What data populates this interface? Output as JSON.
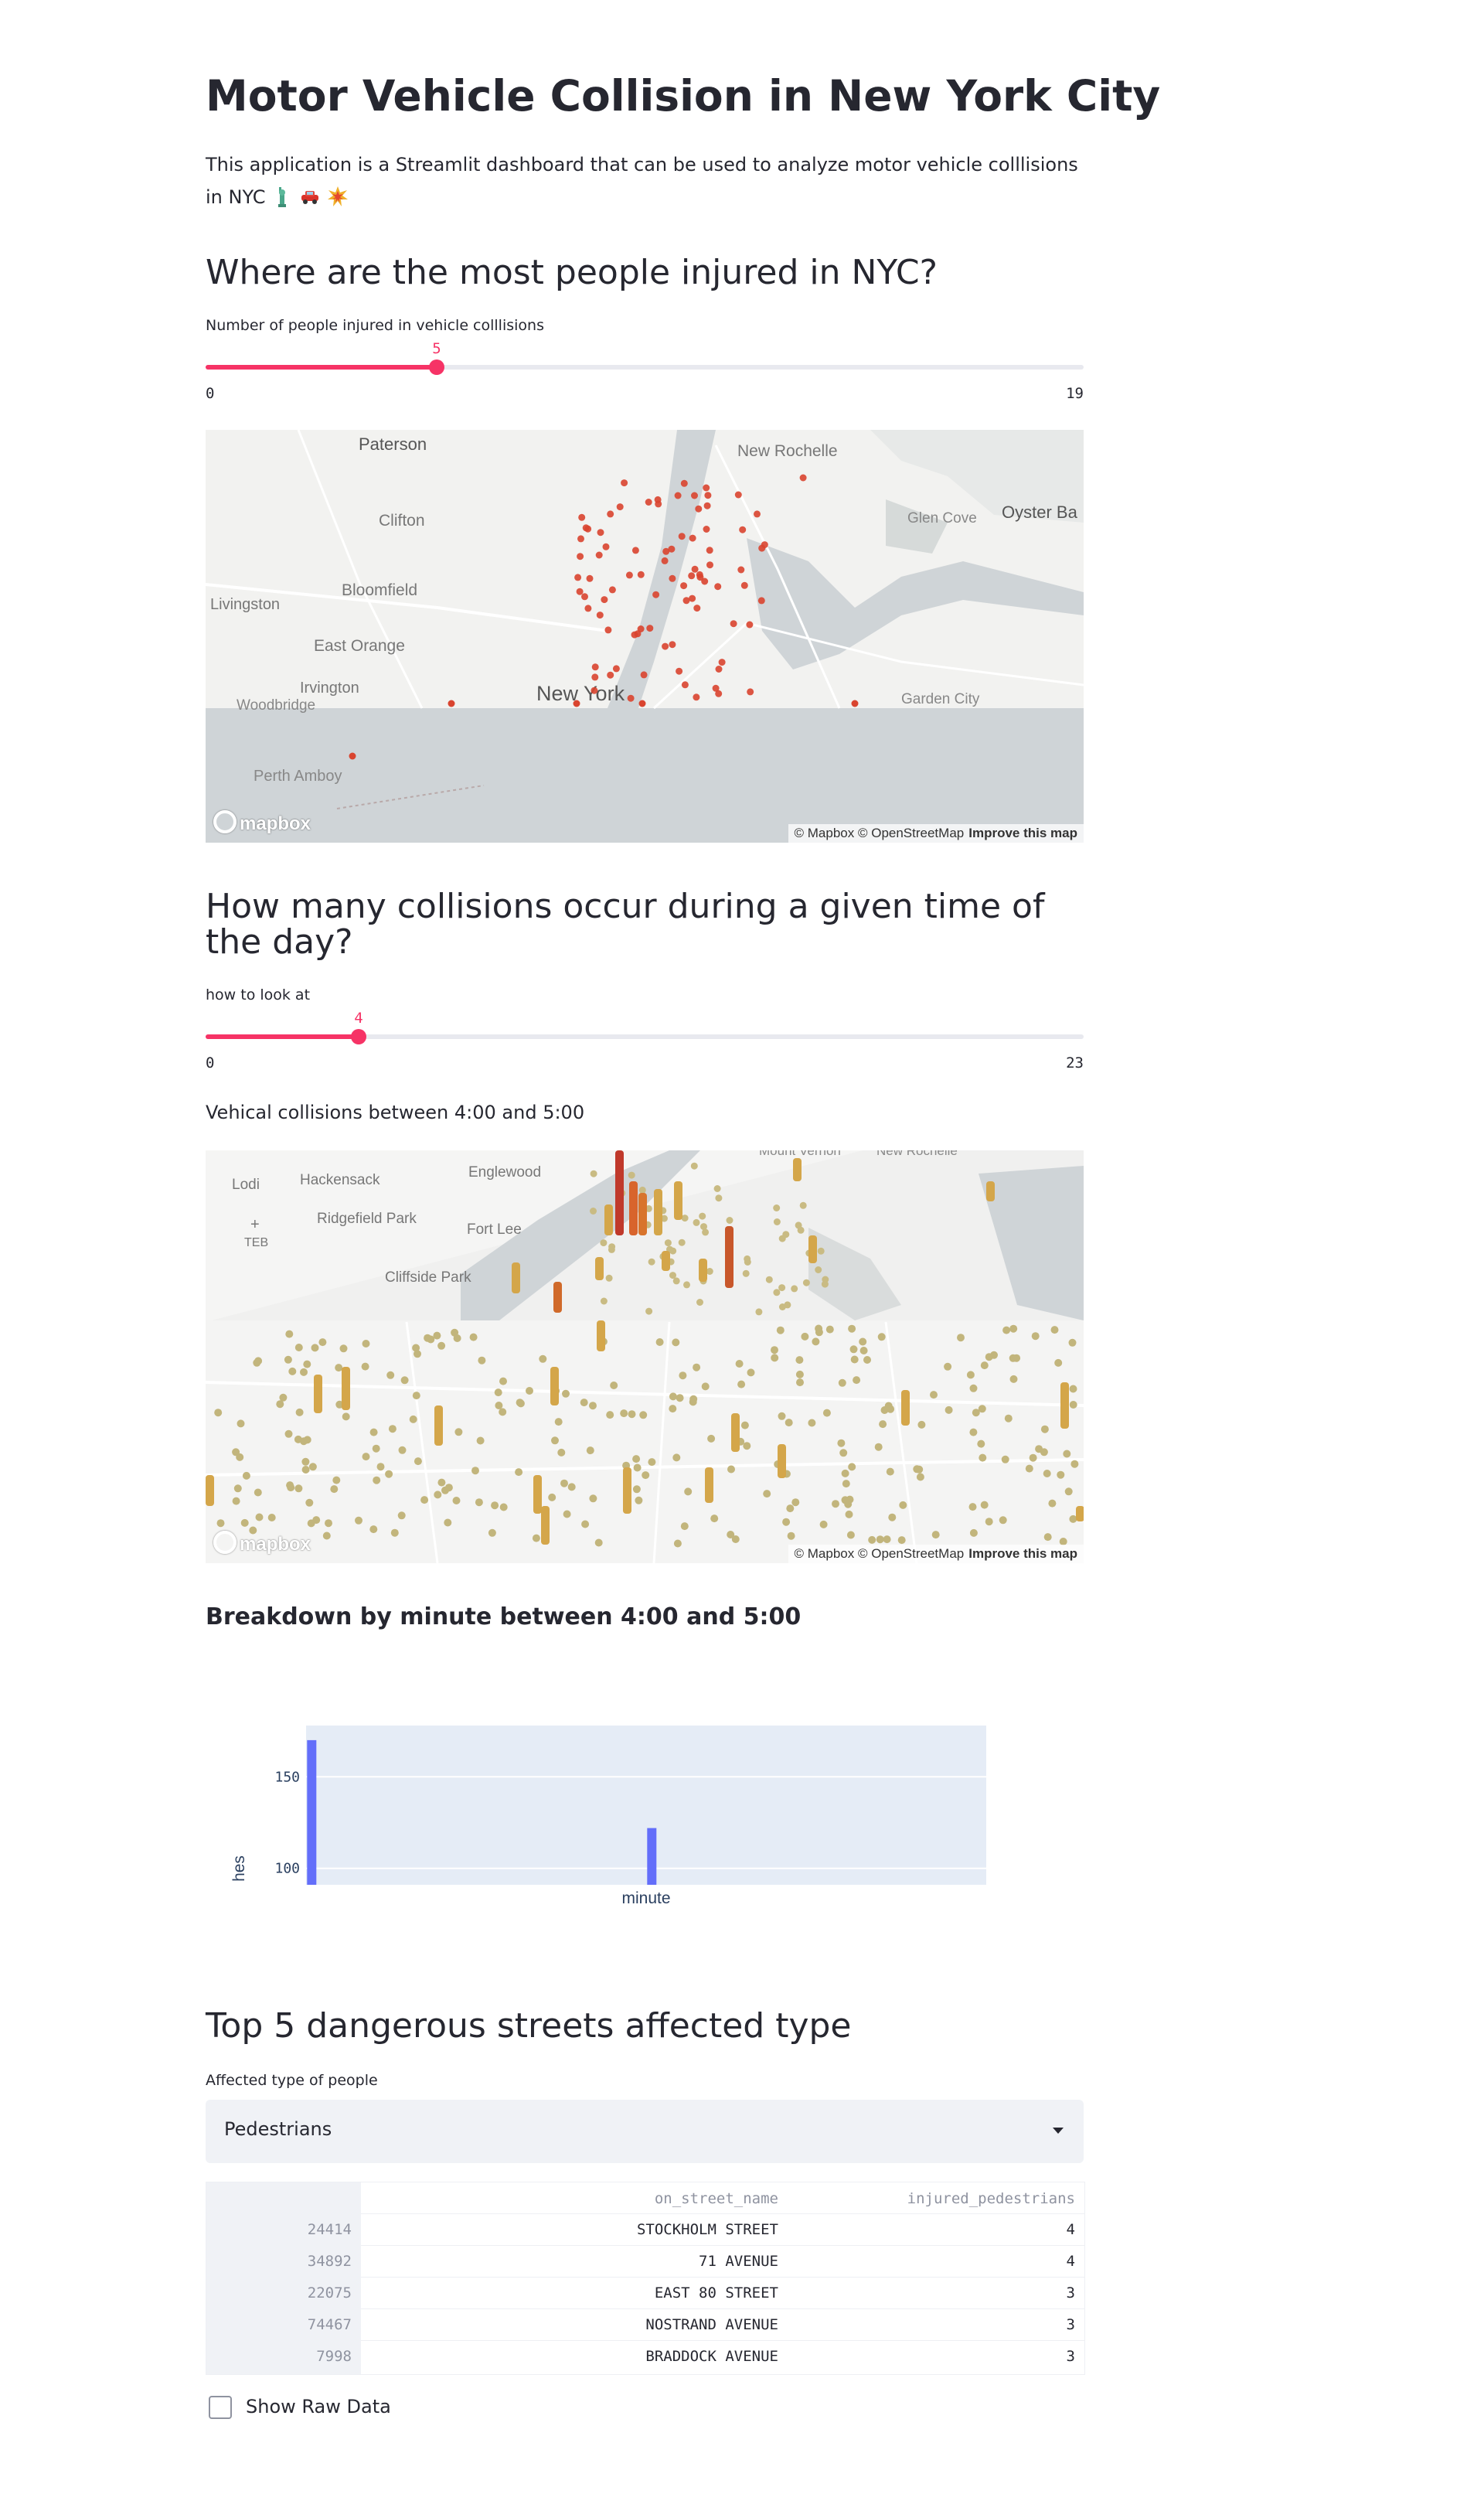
{
  "header": {
    "title": "Motor Vehicle Collision in New York City",
    "subtitle": "This application is a Streamlit dashboard that can be used to analyze motor vehicle colllisions in NYC",
    "emojis": [
      "statue-of-liberty-icon",
      "car-icon",
      "collision-icon"
    ]
  },
  "section1": {
    "heading": "Where are the most people injured in NYC?",
    "slider": {
      "label": "Number of people injured in vehicle colllisions",
      "value": "5",
      "min": "0",
      "max": "19",
      "fraction": 0.263
    },
    "map": {
      "labels": [
        "Paterson",
        "New Rochelle",
        "Clifton",
        "Glen Cove",
        "Oyster Ba",
        "Livingston",
        "Bloomfield",
        "East Orange",
        "Irvington",
        "Woodbridge",
        "New York",
        "Garden City",
        "Perth Amboy"
      ],
      "attribution": "© Mapbox © OpenStreetMap",
      "improve": "Improve this map",
      "logo": "mapbox"
    }
  },
  "section2": {
    "heading": "How many collisions occur during a given time of the day?",
    "slider": {
      "label": "how to look at",
      "value": "4",
      "min": "0",
      "max": "23",
      "fraction": 0.174
    },
    "caption": "Vehical collisions between 4:00 and 5:00",
    "map": {
      "labels": [
        "Lodi",
        "Hackensack",
        "Englewood",
        "Mount Vernon",
        "New Rochelle",
        "Ridgefield Park",
        "Fort Lee",
        "TEB",
        "Cliffside Park"
      ],
      "attribution": "© Mapbox © OpenStreetMap",
      "improve": "Improve this map",
      "logo": "mapbox"
    }
  },
  "section3": {
    "heading": "Breakdown by minute between 4:00 and 5:00"
  },
  "chart_data": {
    "type": "bar",
    "x": [
      0,
      30
    ],
    "values": [
      170,
      122
    ],
    "xlabel": "minute",
    "ylabel": "hes",
    "yticks": [
      "150",
      "100"
    ],
    "ylim": [
      91,
      178
    ],
    "xlim": [
      -0.5,
      59.5
    ],
    "colors": {
      "bar": "#636efa",
      "plot_bg": "#e5ecf6"
    }
  },
  "section4": {
    "heading": "Top 5 dangerous streets affected type",
    "select": {
      "label": "Affected type of people",
      "value": "Pedestrians"
    },
    "table": {
      "columns": [
        "on_street_name",
        "injured_pedestrians"
      ],
      "rows": [
        {
          "index": "24414",
          "street": "STOCKHOLM STREET",
          "count": "4"
        },
        {
          "index": "34892",
          "street": "71 AVENUE",
          "count": "4"
        },
        {
          "index": "22075",
          "street": "EAST 80 STREET",
          "count": "3"
        },
        {
          "index": "74467",
          "street": "NOSTRAND AVENUE",
          "count": "3"
        },
        {
          "index": "7998",
          "street": "BRADDOCK AVENUE",
          "count": "3"
        }
      ]
    },
    "checkbox": {
      "label": "Show Raw Data",
      "checked": false
    }
  },
  "colors": {
    "accent": "#f63366",
    "text": "#262730",
    "muted": "#8f93a0",
    "bar": "#636efa"
  }
}
